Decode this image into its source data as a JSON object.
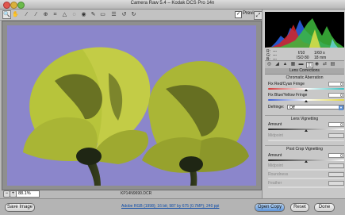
{
  "window": {
    "title": "Camera Raw 5.4  –  Kodak DCS Pro 14n"
  },
  "toolbar": {
    "tools": [
      {
        "icon": "zoom-icon",
        "glyph": "🔍"
      },
      {
        "icon": "hand-icon",
        "glyph": "✋"
      },
      {
        "icon": "white-balance-icon",
        "glyph": "⁄"
      },
      {
        "icon": "color-sampler-icon",
        "glyph": "⁄"
      },
      {
        "icon": "target-adjust-icon",
        "glyph": "⊕"
      },
      {
        "icon": "crop-icon",
        "glyph": "⌗"
      },
      {
        "icon": "straighten-icon",
        "glyph": "△"
      },
      {
        "icon": "spot-removal-icon",
        "glyph": "◌"
      },
      {
        "icon": "red-eye-icon",
        "glyph": "◉"
      },
      {
        "icon": "adjustment-brush-icon",
        "glyph": "✎"
      },
      {
        "icon": "graduated-filter-icon",
        "glyph": "▭"
      },
      {
        "icon": "preferences-icon",
        "glyph": "☰"
      },
      {
        "icon": "rotate-ccw-icon",
        "glyph": "↺"
      },
      {
        "icon": "rotate-cw-icon",
        "glyph": "↻"
      }
    ],
    "preview_label": "Preview",
    "preview_checked": "✓"
  },
  "canvas": {
    "zoom": "88.1%",
    "filename": "KP14N9690.DCR",
    "zoom_out": "−",
    "zoom_in": "+"
  },
  "camera_info": {
    "aperture": "f/10",
    "shutter": "1/60 s",
    "iso": "ISO 80",
    "focal": "18 mm",
    "r": "R:",
    "g": "G:",
    "b": "B:",
    "dashes": "---"
  },
  "panel": {
    "title": "Lens Corrections",
    "chromatic": {
      "header": "Chromatic Aberration",
      "rc_label": "Fix Red/Cyan Fringe",
      "rc_value": "0",
      "by_label": "Fix Blue/Yellow Fringe",
      "by_value": "0",
      "defringe_label": "Defringe:",
      "defringe_value": "Off"
    },
    "lens_vig": {
      "header": "Lens Vignetting",
      "amount_label": "Amount",
      "amount_value": "0",
      "midpoint_label": "Midpoint",
      "midpoint_value": ""
    },
    "post_crop": {
      "header": "Post Crop Vignetting",
      "amount_label": "Amount",
      "amount_value": "0",
      "midpoint_label": "Midpoint",
      "roundness_label": "Roundness",
      "feather_label": "Feather"
    }
  },
  "footer": {
    "save": "Save Image",
    "workflow": "Adobe RGB (1998); 16 bit; 987 by 675 (0.7MP); 240 ppi",
    "open": "Open Copy",
    "reset": "Reset",
    "done": "Done"
  },
  "colors": {
    "sky": "#8b86cb",
    "petal": "#b7c43b",
    "accent": "#5d93d6"
  }
}
